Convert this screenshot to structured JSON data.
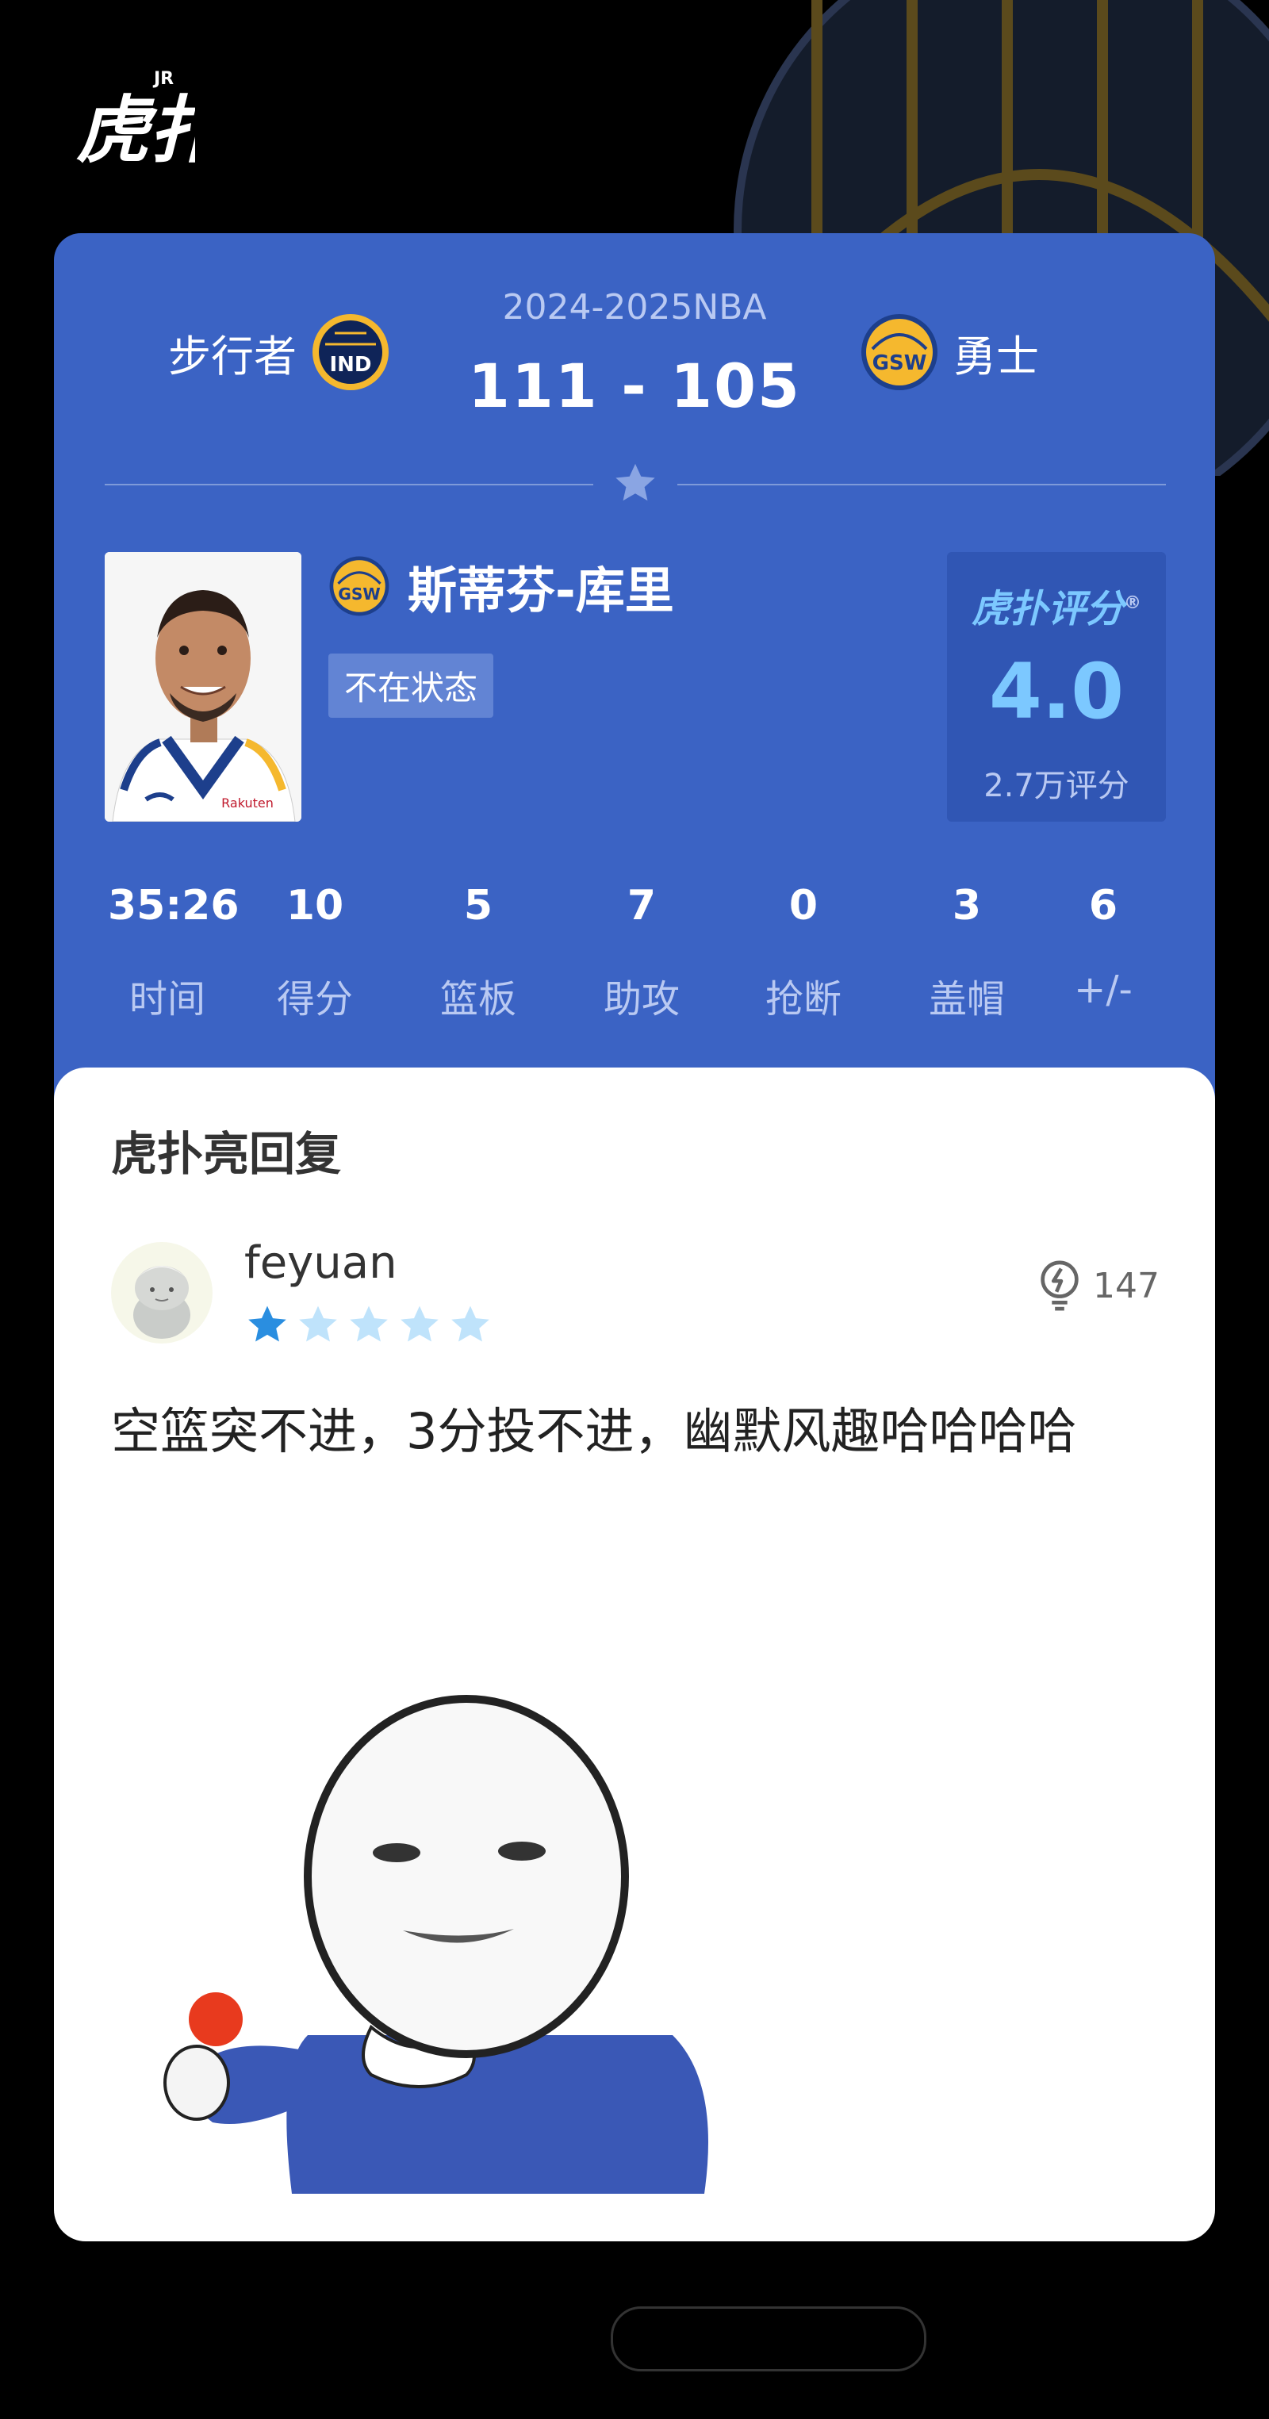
{
  "app": {
    "logo_text": "虎扑",
    "logo_sup": "JR"
  },
  "match": {
    "season": "2024-2025NBA",
    "score": "111  -  105",
    "home": {
      "name": "步行者",
      "abbr": "IND"
    },
    "away": {
      "name": "勇士",
      "abbr": "GSW"
    }
  },
  "player": {
    "name": "斯蒂芬-库里",
    "team_abbr": "GSW",
    "status_tag": "不在状态",
    "jersey_sponsor": "Rakuten"
  },
  "rating": {
    "logo": "虎扑评分",
    "registered": "®",
    "score": "4.0",
    "count": "2.7万评分"
  },
  "stats": [
    {
      "value": "35:26",
      "label": "时间"
    },
    {
      "value": "10",
      "label": "得分"
    },
    {
      "value": "5",
      "label": "篮板"
    },
    {
      "value": "7",
      "label": "助攻"
    },
    {
      "value": "0",
      "label": "抢断"
    },
    {
      "value": "3",
      "label": "盖帽"
    },
    {
      "value": "6",
      "label": "+/-"
    }
  ],
  "reply": {
    "section_title": "虎扑亮回复",
    "username": "feyuan",
    "star_rating": 1,
    "star_max": 5,
    "likes": "147",
    "comment": "空篮突不进，3分投不进，幽默风趣哈哈哈哈"
  },
  "colors": {
    "card_blue": "#3b63c4",
    "accent": "#7cc8ff",
    "star_active": "#2a8ee0",
    "star_inactive": "#bfe3fb"
  }
}
